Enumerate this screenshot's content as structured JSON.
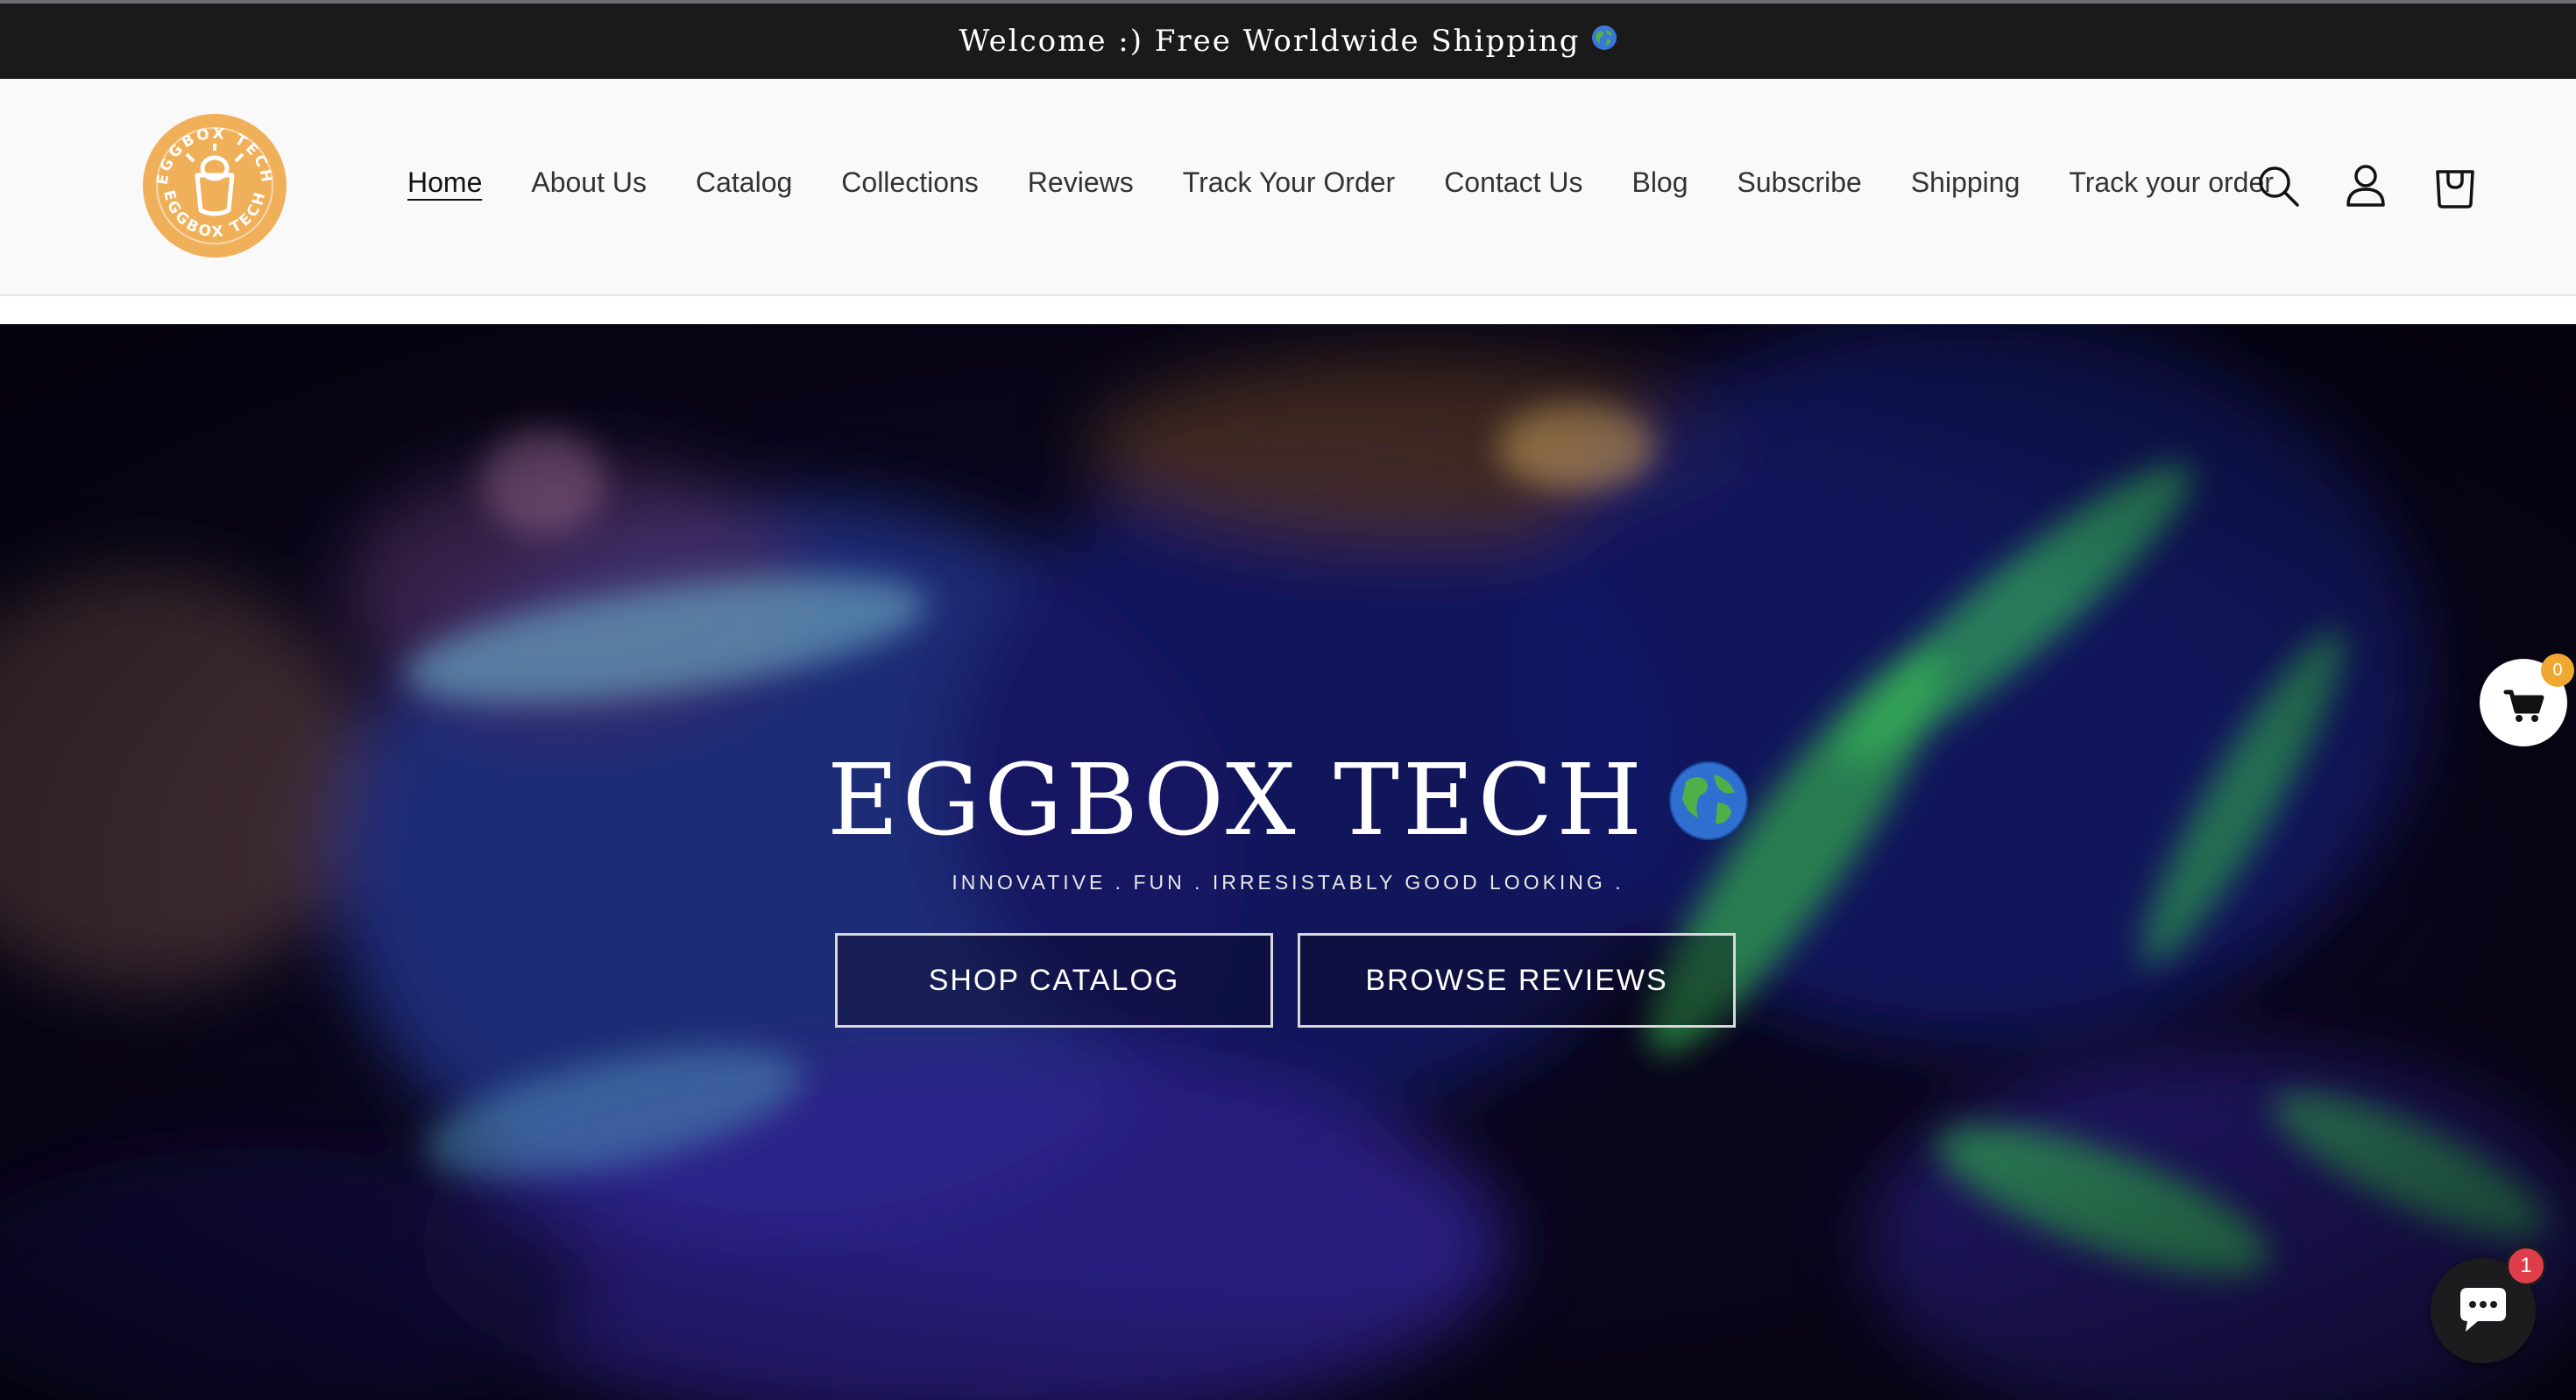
{
  "announcement": {
    "text": "Welcome :) Free Worldwide Shipping",
    "icon": "globe-icon"
  },
  "brand": {
    "logo_text": "EGGBOX TECH",
    "logo_color": "#f0b05a"
  },
  "nav": {
    "items": [
      {
        "label": "Home",
        "active": true
      },
      {
        "label": "About Us"
      },
      {
        "label": "Catalog"
      },
      {
        "label": "Collections"
      },
      {
        "label": "Reviews"
      },
      {
        "label": "Track Your Order"
      },
      {
        "label": "Contact Us"
      },
      {
        "label": "Blog"
      },
      {
        "label": "Subscribe"
      },
      {
        "label": "Shipping"
      },
      {
        "label": "Track your order"
      }
    ]
  },
  "header_icons": [
    "search-icon",
    "account-icon",
    "cart-icon"
  ],
  "hero": {
    "title": "EGGBOX TECH",
    "title_icon": "globe-icon",
    "subtitle": "INNOVATIVE . FUN . IRRESISTABLY GOOD LOOKING .",
    "primary_button": "SHOP CATALOG",
    "secondary_button": "BROWSE REVIEWS"
  },
  "floating_cart": {
    "count": "0",
    "badge_color": "#f0a830"
  },
  "chat": {
    "unread": "1",
    "badge_color": "#e03d4a"
  }
}
